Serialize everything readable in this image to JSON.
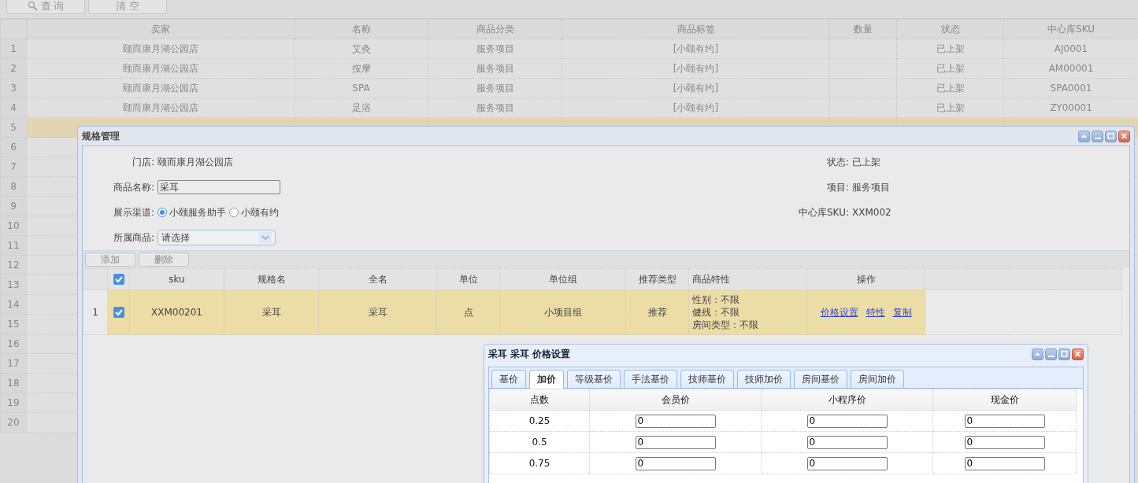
{
  "toolbar": {
    "buttons": [
      {
        "label": "查 询",
        "kind": "search"
      },
      {
        "label": "清 空",
        "kind": "plain"
      }
    ]
  },
  "grid": {
    "columns": [
      "卖家",
      "名称",
      "商品分类",
      "商品标签",
      "数量",
      "状态",
      "中心库SKU"
    ],
    "rows": [
      {
        "number": "1",
        "selected": false,
        "cells": [
          "颐而康月湖公园店",
          "艾灸",
          "服务项目",
          "[小颐有约]",
          "",
          "已上架",
          "AJ0001"
        ]
      },
      {
        "number": "2",
        "selected": false,
        "cells": [
          "颐而康月湖公园店",
          "按摩",
          "服务项目",
          "[小颐有约]",
          "",
          "已上架",
          "AM00001"
        ]
      },
      {
        "number": "3",
        "selected": false,
        "cells": [
          "颐而康月湖公园店",
          "SPA",
          "服务项目",
          "[小颐有约]",
          "",
          "已上架",
          "SPA0001"
        ]
      },
      {
        "number": "4",
        "selected": false,
        "cells": [
          "颐而康月湖公园店",
          "足浴",
          "服务项目",
          "[小颐有约]",
          "",
          "已上架",
          "ZY00001"
        ]
      },
      {
        "number": "5",
        "selected": true
      },
      {
        "number": "6",
        "selected": false
      },
      {
        "number": "7",
        "selected": false
      },
      {
        "number": "8",
        "selected": false
      },
      {
        "number": "9",
        "selected": false
      },
      {
        "number": "10",
        "selected": false
      },
      {
        "number": "11",
        "selected": false
      },
      {
        "number": "12",
        "selected": false
      },
      {
        "number": "13",
        "selected": false
      },
      {
        "number": "14",
        "selected": false
      },
      {
        "number": "15",
        "selected": false
      },
      {
        "number": "16",
        "selected": false
      },
      {
        "number": "17",
        "selected": false
      },
      {
        "number": "18",
        "selected": false
      },
      {
        "number": "19",
        "selected": false
      },
      {
        "number": "20",
        "selected": false
      }
    ]
  },
  "spec_dialog": {
    "title": "规格管理",
    "store": {
      "label": "门店:",
      "value": "颐而康月湖公园店"
    },
    "status": {
      "label": "状态:",
      "value": "已上架"
    },
    "product_name": {
      "label": "商品名称:",
      "value": "采耳"
    },
    "project": {
      "label": "项目:",
      "value": "服务项目"
    },
    "channel": {
      "label": "展示渠道:",
      "options": [
        {
          "label": "小颐服务助手",
          "selected": true
        },
        {
          "label": "小颐有约",
          "selected": false
        }
      ]
    },
    "center_sku": {
      "label": "中心库SKU:",
      "value": "XXM002"
    },
    "parent_product": {
      "label": "所属商品:",
      "value": "请选择"
    },
    "buttons": [
      "添加",
      "删除"
    ],
    "header_checked": true,
    "columns": [
      "sku",
      "规格名",
      "全名",
      "单位",
      "单位组",
      "推荐类型",
      "商品特性",
      "操作"
    ],
    "rows": [
      {
        "number": "1",
        "checked": true,
        "selected": true,
        "cells": [
          "XXM00201",
          "采耳",
          "采耳",
          "点",
          "小项目组",
          "推荐"
        ],
        "traits": [
          "性别：不限",
          "健残：不限",
          "房间类型：不限"
        ],
        "actions": [
          "价格设置",
          "特性",
          "复制"
        ]
      }
    ]
  },
  "price_dialog": {
    "title": "采耳 采耳 价格设置",
    "tabs": [
      {
        "label": "基价",
        "selected": false
      },
      {
        "label": "加价",
        "selected": true
      },
      {
        "label": "等级基价",
        "selected": false
      },
      {
        "label": "手法基价",
        "selected": false
      },
      {
        "label": "技师基价",
        "selected": false
      },
      {
        "label": "技师加价",
        "selected": false
      },
      {
        "label": "房间基价",
        "selected": false
      },
      {
        "label": "房间加价",
        "selected": false
      }
    ],
    "columns": [
      "点数",
      "会员价",
      "小程序价",
      "现金价"
    ],
    "rows": [
      {
        "points": "0.25",
        "values": [
          "0",
          "0",
          "0"
        ]
      },
      {
        "points": "0.5",
        "values": [
          "0",
          "0",
          "0"
        ]
      },
      {
        "points": "0.75",
        "values": [
          "0",
          "0",
          "0"
        ]
      }
    ]
  }
}
